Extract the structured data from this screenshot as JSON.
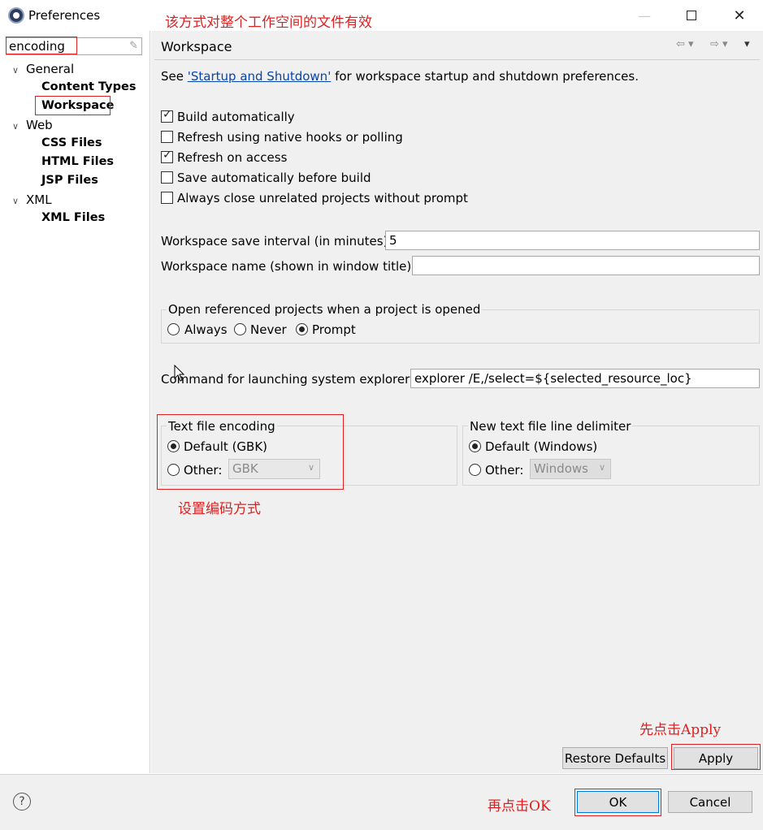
{
  "window": {
    "title": "Preferences",
    "annotation_top": "该方式对整个工作空间的文件有效"
  },
  "sidebar": {
    "filter_value": "encoding",
    "items": [
      {
        "label": "General"
      },
      {
        "label": "Content Types"
      },
      {
        "label": "Workspace"
      },
      {
        "label": "Web"
      },
      {
        "label": "CSS Files"
      },
      {
        "label": "HTML Files"
      },
      {
        "label": "JSP Files"
      },
      {
        "label": "XML"
      },
      {
        "label": "XML Files"
      }
    ]
  },
  "page": {
    "title": "Workspace",
    "intro_prefix": "See ",
    "intro_link": "'Startup and Shutdown'",
    "intro_suffix": " for workspace startup and shutdown preferences.",
    "checkboxes": [
      {
        "label": "Build automatically",
        "checked": true
      },
      {
        "label": "Refresh using native hooks or polling",
        "checked": false
      },
      {
        "label": "Refresh on access",
        "checked": true
      },
      {
        "label": "Save automatically before build",
        "checked": false
      },
      {
        "label": "Always close unrelated projects without prompt",
        "checked": false
      }
    ],
    "save_interval_label": "Workspace save interval (in minutes):",
    "save_interval_value": "5",
    "workspace_name_label": "Workspace name (shown in window title):",
    "workspace_name_value": "",
    "open_ref": {
      "title": "Open referenced projects when a project is opened",
      "options": [
        {
          "label": "Always",
          "selected": false
        },
        {
          "label": "Never",
          "selected": false
        },
        {
          "label": "Prompt",
          "selected": true
        }
      ]
    },
    "explorer_label": "Command for launching system explorer:",
    "explorer_value": "explorer /E,/select=${selected_resource_loc}",
    "encoding": {
      "title": "Text file encoding",
      "default_label": "Default (GBK)",
      "other_label": "Other:",
      "other_value": "GBK",
      "selected": "default"
    },
    "line_delimiter": {
      "title": "New text file line delimiter",
      "default_label": "Default (Windows)",
      "other_label": "Other:",
      "other_value": "Windows",
      "selected": "default"
    },
    "annotation_encoding": "设置编码方式",
    "annotation_apply": "先点击Apply",
    "restore_label": "Restore Defaults",
    "apply_label": "Apply"
  },
  "footer": {
    "annotation_ok": "再点击OK",
    "ok_label": "OK",
    "cancel_label": "Cancel"
  },
  "colors": {
    "annotation": "#e02020",
    "link": "#0645ad",
    "focus": "#0078d7"
  }
}
